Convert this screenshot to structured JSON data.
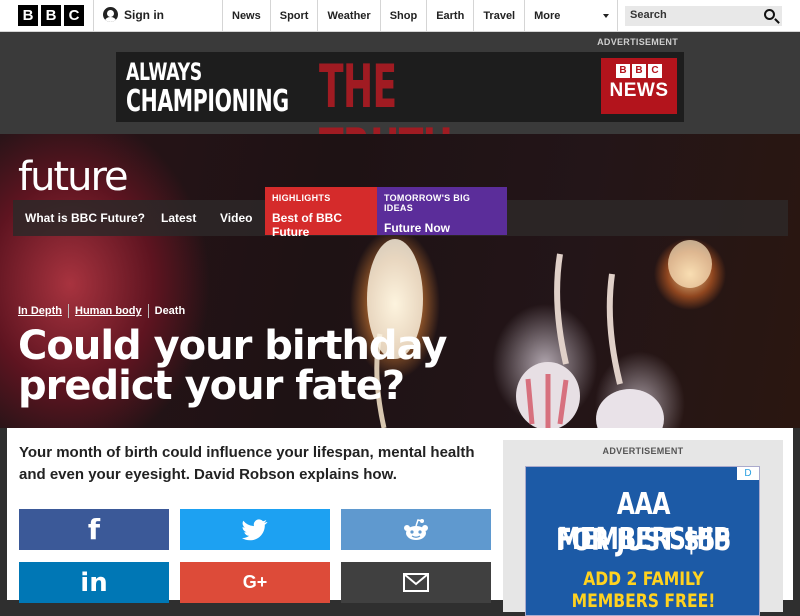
{
  "header": {
    "logo_letters": [
      "B",
      "B",
      "C"
    ],
    "signin_label": "Sign in",
    "nav": [
      "News",
      "Sport",
      "Weather",
      "Shop",
      "Earth",
      "Travel"
    ],
    "more_label": "More",
    "search_placeholder": "Search"
  },
  "top_ad": {
    "label": "ADVERTISEMENT",
    "line1": "ALWAYS",
    "line2": "CHAMPIONING",
    "line3": "THE TRUTH",
    "news_logo_letters": [
      "B",
      "B",
      "C"
    ],
    "news_word": "NEWS"
  },
  "hero": {
    "section_logo": "future",
    "subnav": [
      "What is BBC Future?",
      "Latest",
      "Video"
    ],
    "highlights": {
      "title": "HIGHLIGHTS",
      "value": "Best of BBC Future",
      "color": "#d52b2b"
    },
    "big_ideas": {
      "title": "TOMORROW'S BIG IDEAS",
      "value": "Future Now",
      "color": "#5b2d9a"
    },
    "tags": [
      "In Depth",
      "Human body",
      "Death"
    ],
    "headline": "Could your birthday predict your fate?"
  },
  "article": {
    "intro": "Your month of birth could influence your lifespan, mental health and even your eyesight. David Robson explains how.",
    "share_buttons": [
      {
        "name": "facebook",
        "glyph": "f",
        "color": "#3b5998"
      },
      {
        "name": "twitter",
        "glyph": "twitter",
        "color": "#1da1f2"
      },
      {
        "name": "reddit",
        "glyph": "reddit",
        "color": "#5f99cf"
      },
      {
        "name": "linkedin",
        "glyph": "in",
        "color": "#0077b5"
      },
      {
        "name": "google-plus",
        "glyph": "G+",
        "color": "#dd4b39"
      },
      {
        "name": "email",
        "glyph": "email",
        "color": "#404040"
      }
    ]
  },
  "side_ad": {
    "label": "ADVERTISEMENT",
    "close": "D",
    "line1": "AAA MEMBERSHIP",
    "line2": "FOR JUST $55",
    "line3": "ADD 2 FAMILY MEMBERS FREE!"
  }
}
